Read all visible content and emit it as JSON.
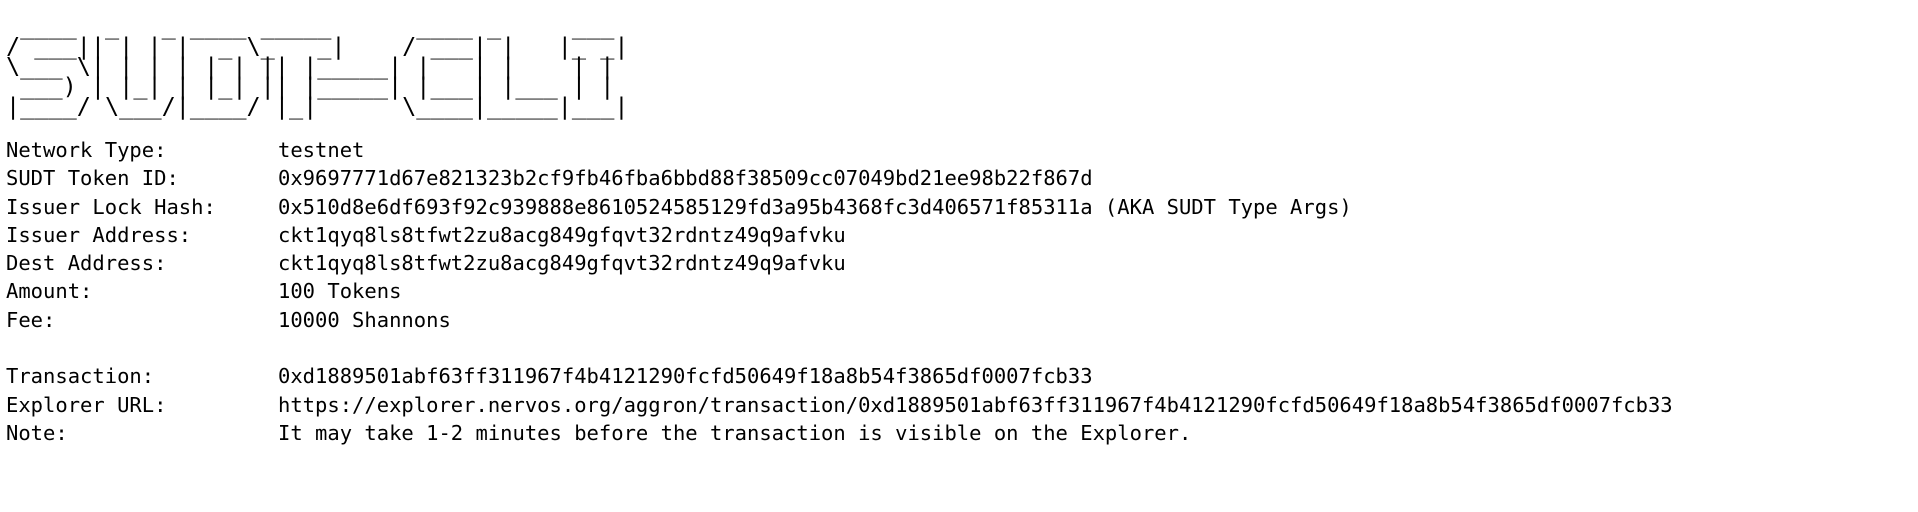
{
  "banner": {
    "lines": [
      " ____  _   _ ____ _____      ____ _     ___",
      "/ ___|| | | |  _ \\_   _|    / ___| |   |_ _|",
      "\\___ \\| | | | | | || |_____| |   | |    | |",
      " ___) | |_| | |_| || |_____| |___| |___ | |",
      "|____/ \\___/|____/ |_|      \\____|_____|___|"
    ]
  },
  "details": {
    "network_type": {
      "label": "Network Type:",
      "value": "testnet"
    },
    "sudt_token_id": {
      "label": "SUDT Token ID:",
      "value": "0x9697771d67e821323b2cf9fb46fba6bbd88f38509cc07049bd21ee98b22f867d"
    },
    "issuer_lock_hash": {
      "label": "Issuer Lock Hash:",
      "value": "0x510d8e6df693f92c939888e8610524585129fd3a95b4368fc3d406571f85311a (AKA SUDT Type Args)"
    },
    "issuer_address": {
      "label": "Issuer Address:",
      "value": "ckt1qyq8ls8tfwt2zu8acg849gfqvt32rdntz49q9afvku"
    },
    "dest_address": {
      "label": "Dest Address:",
      "value": "ckt1qyq8ls8tfwt2zu8acg849gfqvt32rdntz49q9afvku"
    },
    "amount": {
      "label": "Amount:",
      "value": "100 Tokens"
    },
    "fee": {
      "label": "Fee:",
      "value": "10000 Shannons"
    }
  },
  "result": {
    "transaction": {
      "label": "Transaction:",
      "value": "0xd1889501abf63ff311967f4b4121290fcfd50649f18a8b54f3865df0007fcb33"
    },
    "explorer_url": {
      "label": "Explorer URL:",
      "value": "https://explorer.nervos.org/aggron/transaction/0xd1889501abf63ff311967f4b4121290fcfd50649f18a8b54f3865df0007fcb33"
    },
    "note": {
      "label": "Note:",
      "value": "It may take 1-2 minutes before the transaction is visible on the Explorer."
    }
  }
}
